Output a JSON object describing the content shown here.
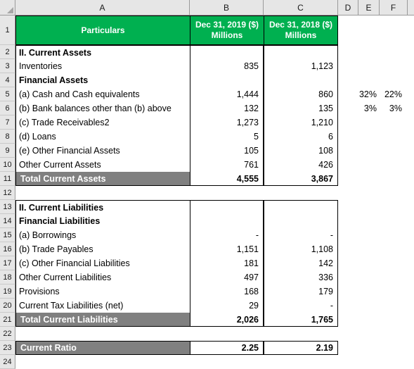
{
  "app": {
    "type": "spreadsheet",
    "colors": {
      "header_green": "#00B050",
      "total_gray": "#808080",
      "header_strip": "#E6E6E6",
      "grid_border": "#000000"
    }
  },
  "column_headers": [
    "A",
    "B",
    "C",
    "D",
    "E",
    "F"
  ],
  "row_headers": [
    "1",
    "2",
    "3",
    "4",
    "5",
    "6",
    "7",
    "8",
    "9",
    "10",
    "11",
    "12",
    "13",
    "14",
    "15",
    "16",
    "17",
    "18",
    "19",
    "20",
    "21",
    "22",
    "23",
    "24"
  ],
  "table": {
    "header": {
      "particulars": "Particulars",
      "col_b_line1": "Dec 31, 2019 ($)",
      "col_b_line2": "Millions",
      "col_c_line1": "Dec 31, 2018 ($)",
      "col_c_line2": "Millions"
    },
    "rows": [
      {
        "row": "2",
        "a": "II. Current Assets",
        "b": "",
        "c": "",
        "e": "",
        "f": "",
        "style": "bold"
      },
      {
        "row": "3",
        "a": "Inventories",
        "b": "835",
        "c": "1,123",
        "e": "",
        "f": "",
        "style": "normal"
      },
      {
        "row": "4",
        "a": "Financial Assets",
        "b": "",
        "c": "",
        "e": "",
        "f": "",
        "style": "bold"
      },
      {
        "row": "5",
        "a": "(a) Cash and Cash equivalents",
        "b": "1,444",
        "c": "860",
        "e": "32%",
        "f": "22%",
        "style": "normal"
      },
      {
        "row": "6",
        "a": "(b) Bank balances other than (b) above",
        "b": "132",
        "c": "135",
        "e": "3%",
        "f": "3%",
        "style": "normal"
      },
      {
        "row": "7",
        "a": "(c) Trade Receivables2",
        "b": "1,273",
        "c": "1,210",
        "e": "",
        "f": "",
        "style": "normal"
      },
      {
        "row": "8",
        "a": "(d) Loans",
        "b": "5",
        "c": "6",
        "e": "",
        "f": "",
        "style": "normal"
      },
      {
        "row": "9",
        "a": "(e) Other Financial Assets",
        "b": "105",
        "c": "108",
        "e": "",
        "f": "",
        "style": "normal"
      },
      {
        "row": "10",
        "a": "Other Current Assets",
        "b": "761",
        "c": "426",
        "e": "",
        "f": "",
        "style": "normal"
      },
      {
        "row": "11",
        "a": "Total Current Assets",
        "b": "4,555",
        "c": "3,867",
        "e": "",
        "f": "",
        "style": "total"
      },
      {
        "row": "12",
        "a": "",
        "b": "",
        "c": "",
        "e": "",
        "f": "",
        "style": "blank"
      },
      {
        "row": "13",
        "a": "II. Current Liabilities",
        "b": "",
        "c": "",
        "e": "",
        "f": "",
        "style": "bold"
      },
      {
        "row": "14",
        "a": "Financial Liabilities",
        "b": "",
        "c": "",
        "e": "",
        "f": "",
        "style": "bold"
      },
      {
        "row": "15",
        "a": "(a) Borrowings",
        "b": "-",
        "c": "-",
        "e": "",
        "f": "",
        "style": "normal"
      },
      {
        "row": "16",
        "a": "(b) Trade Payables",
        "b": "1,151",
        "c": "1,108",
        "e": "",
        "f": "",
        "style": "normal"
      },
      {
        "row": "17",
        "a": "(c) Other Financial Liabilities",
        "b": "181",
        "c": "142",
        "e": "",
        "f": "",
        "style": "normal"
      },
      {
        "row": "18",
        "a": "Other Current Liabilities",
        "b": "497",
        "c": "336",
        "e": "",
        "f": "",
        "style": "normal"
      },
      {
        "row": "19",
        "a": "Provisions",
        "b": "168",
        "c": "179",
        "e": "",
        "f": "",
        "style": "normal"
      },
      {
        "row": "20",
        "a": "Current Tax Liabilities (net)",
        "b": "29",
        "c": "-",
        "e": "",
        "f": "",
        "style": "normal"
      },
      {
        "row": "21",
        "a": "Total Current Liabilities",
        "b": "2,026",
        "c": "1,765",
        "e": "",
        "f": "",
        "style": "total"
      },
      {
        "row": "22",
        "a": "",
        "b": "",
        "c": "",
        "e": "",
        "f": "",
        "style": "blank"
      },
      {
        "row": "23",
        "a": "Current Ratio",
        "b": "2.25",
        "c": "2.19",
        "e": "",
        "f": "",
        "style": "total"
      },
      {
        "row": "24",
        "a": "",
        "b": "",
        "c": "",
        "e": "",
        "f": "",
        "style": "blank"
      }
    ]
  }
}
